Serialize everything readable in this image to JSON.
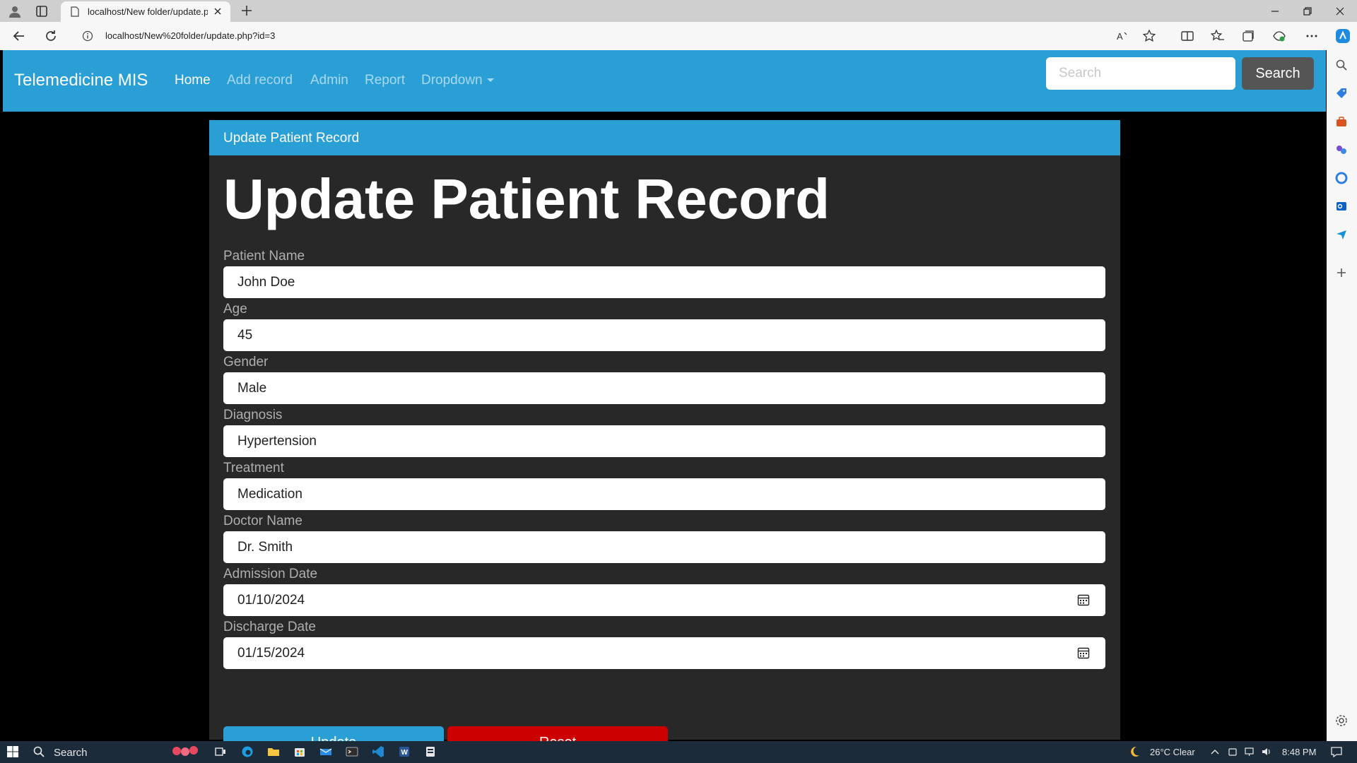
{
  "browser": {
    "tab_title": "localhost/New folder/update.php",
    "url": "localhost/New%20folder/update.php?id=3"
  },
  "navbar": {
    "brand": "Telemedicine MIS",
    "links": [
      "Home",
      "Add record",
      "Admin",
      "Report",
      "Dropdown"
    ],
    "search_placeholder": "Search",
    "search_button": "Search"
  },
  "card": {
    "header": "Update Patient Record",
    "title": "Update Patient Record",
    "fields": [
      {
        "label": "Patient Name",
        "value": "John Doe"
      },
      {
        "label": "Age",
        "value": "45"
      },
      {
        "label": "Gender",
        "value": "Male"
      },
      {
        "label": "Diagnosis",
        "value": "Hypertension"
      },
      {
        "label": "Treatment",
        "value": "Medication"
      },
      {
        "label": "Doctor Name",
        "value": "Dr. Smith"
      },
      {
        "label": "Admission Date",
        "value": "01/10/2024"
      },
      {
        "label": "Discharge Date",
        "value": "01/15/2024"
      }
    ],
    "update_button": "Update",
    "reset_button": "Reset"
  },
  "taskbar": {
    "search_label": "Search",
    "weather": "26°C Clear",
    "time": "8:48 PM"
  },
  "colors": {
    "primary": "#2a9fd6",
    "danger": "#cc0000",
    "card_bg": "#282828",
    "page_bg": "#000000"
  }
}
